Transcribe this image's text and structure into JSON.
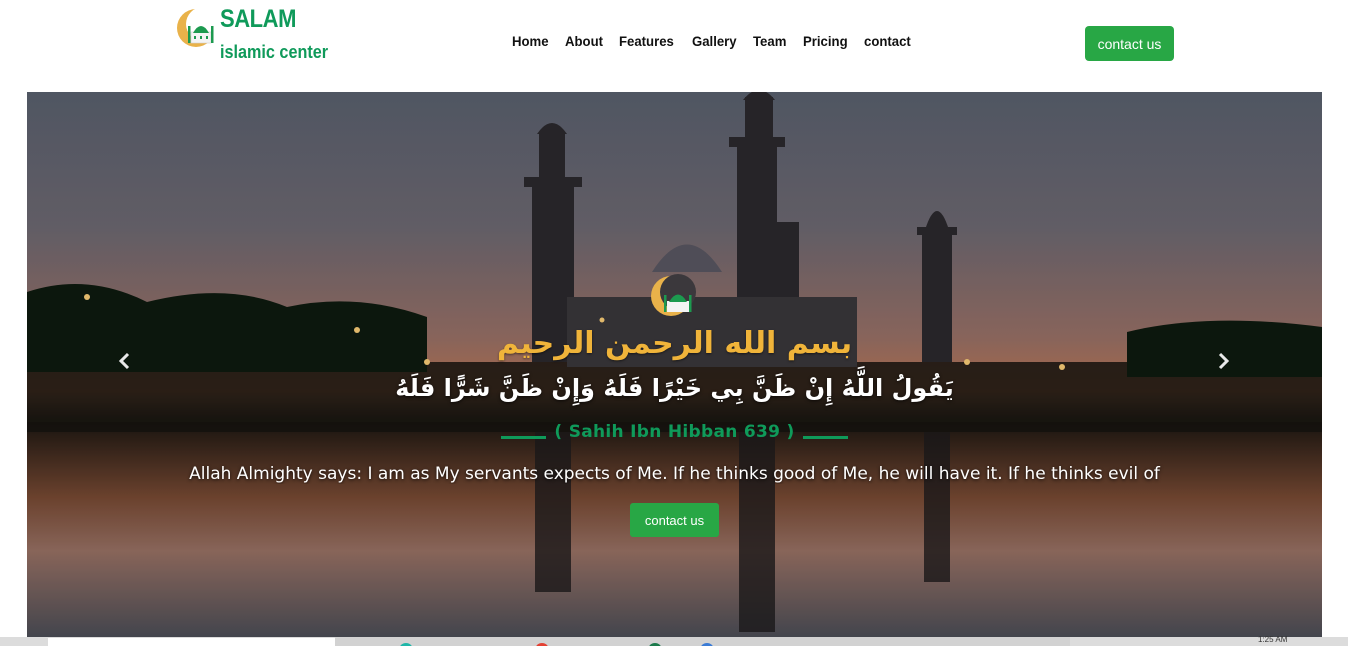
{
  "brand": {
    "title": "SALAM",
    "subtitle": "islamic center",
    "logo_icon": "crescent-mosque-icon",
    "color": "#0f9a5a"
  },
  "nav": {
    "items": [
      "Home",
      "About",
      "Features",
      "Gallery",
      "Team",
      "Pricing",
      "contact"
    ]
  },
  "header_button": {
    "label": "contact us",
    "color": "#28a745"
  },
  "hero": {
    "basmala": "بسم الله الرحمن الرحيم",
    "hadith_arabic": "يَقُولُ اللَّهُ إِنْ ظَنَّ بِي خَيْرًا فَلَهُ وَإِنْ ظَنَّ شَرًّا فَلَهُ",
    "source": "( Sahih Ibn Hibban 639 )",
    "translation": "Allah Almighty says: I am as My servants expects of Me. If he thinks good of Me, he will have it. If he thinks evil of",
    "button_label": "contact us",
    "prev_icon": "chevron-left-icon",
    "next_icon": "chevron-right-icon",
    "accent_gold": "#f0b43a",
    "accent_green": "#0f9a5a"
  },
  "taskbar": {
    "clock": "1:25 AM"
  }
}
